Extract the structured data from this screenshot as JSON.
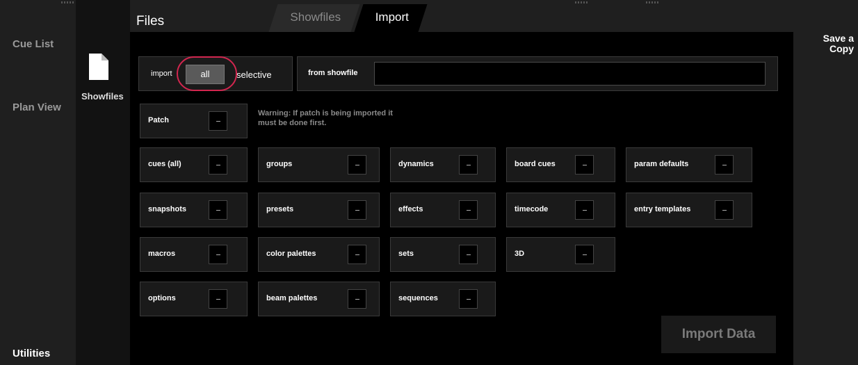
{
  "left_nav": {
    "items": [
      {
        "label": "Cue List"
      },
      {
        "label": "Plan View"
      },
      {
        "label": "Utilities"
      }
    ]
  },
  "sub_nav": {
    "label": "Showfiles",
    "icon": "file-icon"
  },
  "right_panel": {
    "save_copy_line1": "Save a",
    "save_copy_line2": "Copy"
  },
  "header": {
    "title": "Files",
    "tabs": [
      {
        "label": "Showfiles",
        "active": false
      },
      {
        "label": "Import",
        "active": true
      }
    ]
  },
  "import_mode": {
    "label": "import",
    "options": [
      "all",
      "selective"
    ],
    "selected": "all"
  },
  "from_showfile": {
    "label": "from showfile",
    "value": ""
  },
  "patch": {
    "label": "Patch",
    "state": "–",
    "warning": "Warning: If patch is being imported it must be done first."
  },
  "options": [
    {
      "label": "cues (all)",
      "state": "–"
    },
    {
      "label": "groups",
      "state": "–"
    },
    {
      "label": "dynamics",
      "state": "–"
    },
    {
      "label": "board cues",
      "state": "–"
    },
    {
      "label": "param defaults",
      "state": "–"
    },
    {
      "label": "snapshots",
      "state": "–"
    },
    {
      "label": "presets",
      "state": "–"
    },
    {
      "label": "effects",
      "state": "–"
    },
    {
      "label": "timecode",
      "state": "–"
    },
    {
      "label": "entry templates",
      "state": "–"
    },
    {
      "label": "macros",
      "state": "–"
    },
    {
      "label": "color palettes",
      "state": "–"
    },
    {
      "label": "sets",
      "state": "–"
    },
    {
      "label": "3D",
      "state": "–"
    },
    {
      "label": "options",
      "state": "–"
    },
    {
      "label": "beam palettes",
      "state": "–"
    },
    {
      "label": "sequences",
      "state": "–"
    }
  ],
  "import_button": {
    "label": "Import Data",
    "enabled": false
  },
  "colors": {
    "background": "#000000",
    "panel": "#1f1f1f",
    "selected_highlight": "#d2264f",
    "disabled_text": "#7a7a7a"
  }
}
